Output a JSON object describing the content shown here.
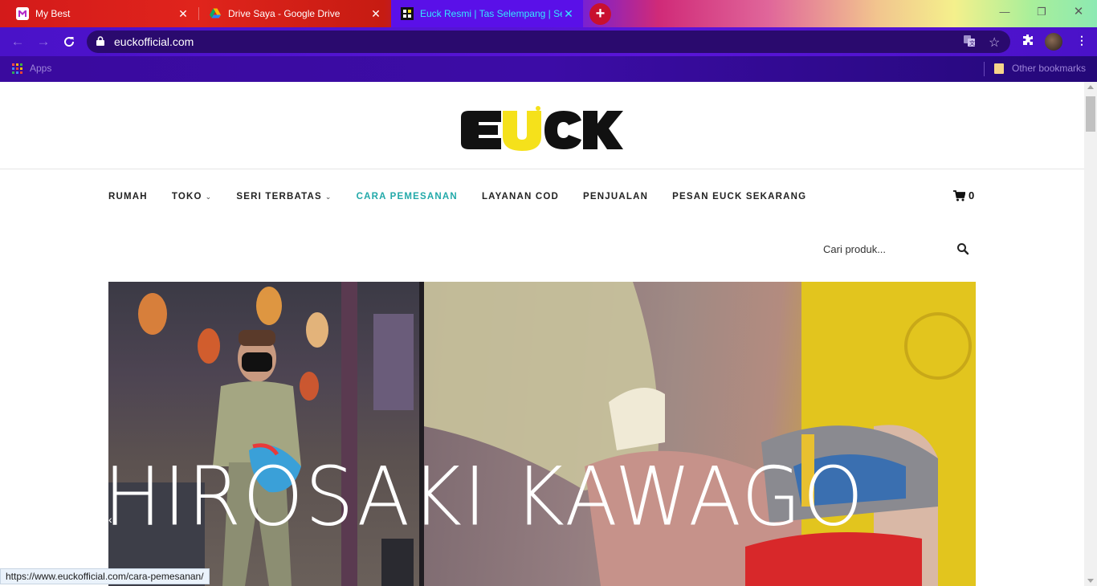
{
  "browser": {
    "tabs": [
      {
        "title": "My Best",
        "active": false
      },
      {
        "title": "Drive Saya - Google Drive",
        "active": false
      },
      {
        "title": "Euck Resmi | Tas Selempang | Sel",
        "active": true
      }
    ],
    "url": "euckofficial.com",
    "bookmarks": {
      "apps_label": "Apps",
      "other_label": "Other bookmarks"
    },
    "status_url": "https://www.euckofficial.com/cara-pemesanan/"
  },
  "site": {
    "logo_text": "EUCK",
    "nav": [
      {
        "label": "RUMAH",
        "dropdown": false,
        "active": false
      },
      {
        "label": "TOKO",
        "dropdown": true,
        "active": false
      },
      {
        "label": "SERI TERBATAS",
        "dropdown": true,
        "active": false
      },
      {
        "label": "CARA PEMESANAN",
        "dropdown": false,
        "active": true
      },
      {
        "label": "LAYANAN COD",
        "dropdown": false,
        "active": false
      },
      {
        "label": "PENJUALAN",
        "dropdown": false,
        "active": false
      },
      {
        "label": "PESAN EUCK SEKARANG",
        "dropdown": false,
        "active": false
      }
    ],
    "cart_count": "0",
    "search_placeholder": "Cari produk...",
    "hero_caption": "HIROSAKI KAWAGO"
  },
  "colors": {
    "accent": "#22a9a9",
    "tab_active": "#5a10e8",
    "logo_yellow": "#f5e11b"
  }
}
